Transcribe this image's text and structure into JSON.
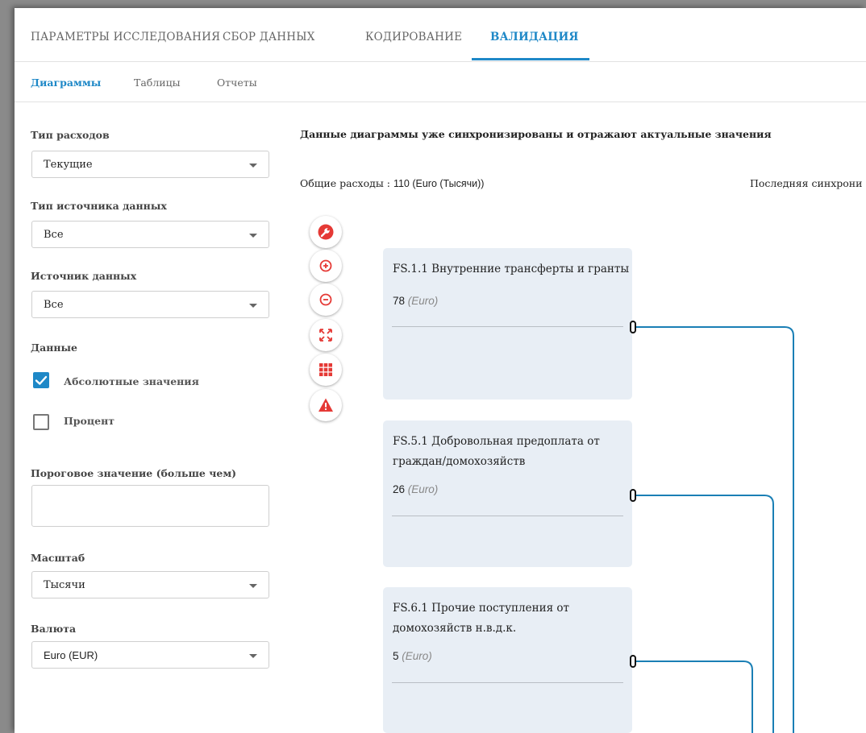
{
  "top_tabs": [
    "ПАРАМЕТРЫ ИССЛЕДОВАНИЯ",
    "СБОР ДАННЫХ",
    "КОДИРОВАНИЕ",
    "ВАЛИДАЦИЯ"
  ],
  "sub_tabs": [
    "Диаграммы",
    "Таблицы",
    "Отчеты"
  ],
  "sidebar": {
    "expense_type_label": "Тип расходов",
    "expense_type_value": "Текущие",
    "source_type_label": "Тип источника данных",
    "source_type_value": "Все",
    "source_label": "Источник данных",
    "source_value": "Все",
    "data_label": "Данные",
    "absolute_label": "Абсолютные значения",
    "absolute_checked": true,
    "percent_label": "Процент",
    "percent_checked": false,
    "threshold_label": "Пороговое значение (больше чем)",
    "threshold_value": "",
    "scale_label": "Масштаб",
    "scale_value": "Тысячи",
    "currency_label": "Валюта",
    "currency_value": "Euro (EUR)"
  },
  "main": {
    "headline": "Данные диаграммы уже синхронизированы и отражают актуальные значения",
    "total_label": "Общие расходы : ",
    "total_value": "110 (Euro (Тысячи))",
    "last_sync": "Последняя синхрони"
  },
  "tools": [
    "wrench-icon",
    "zoom-in-icon",
    "zoom-out-icon",
    "expand-icon",
    "grid-icon",
    "warning-icon"
  ],
  "cards": [
    {
      "title": "FS.1.1 Внутренние трансферты и гранты",
      "value": "78",
      "unit": "(Euro)"
    },
    {
      "title": "FS.5.1 Добровольная предоплата от граждан/домохозяйств",
      "value": "26",
      "unit": "(Euro)"
    },
    {
      "title": "FS.6.1 Прочие поступления от домохозяйств н.в.д.к.",
      "value": "5",
      "unit": "(Euro)"
    }
  ],
  "colors": {
    "accent": "#1e88c7",
    "tool_red": "#e53935",
    "link": "#1a7fb5",
    "card_bg": "#e8eef5"
  }
}
